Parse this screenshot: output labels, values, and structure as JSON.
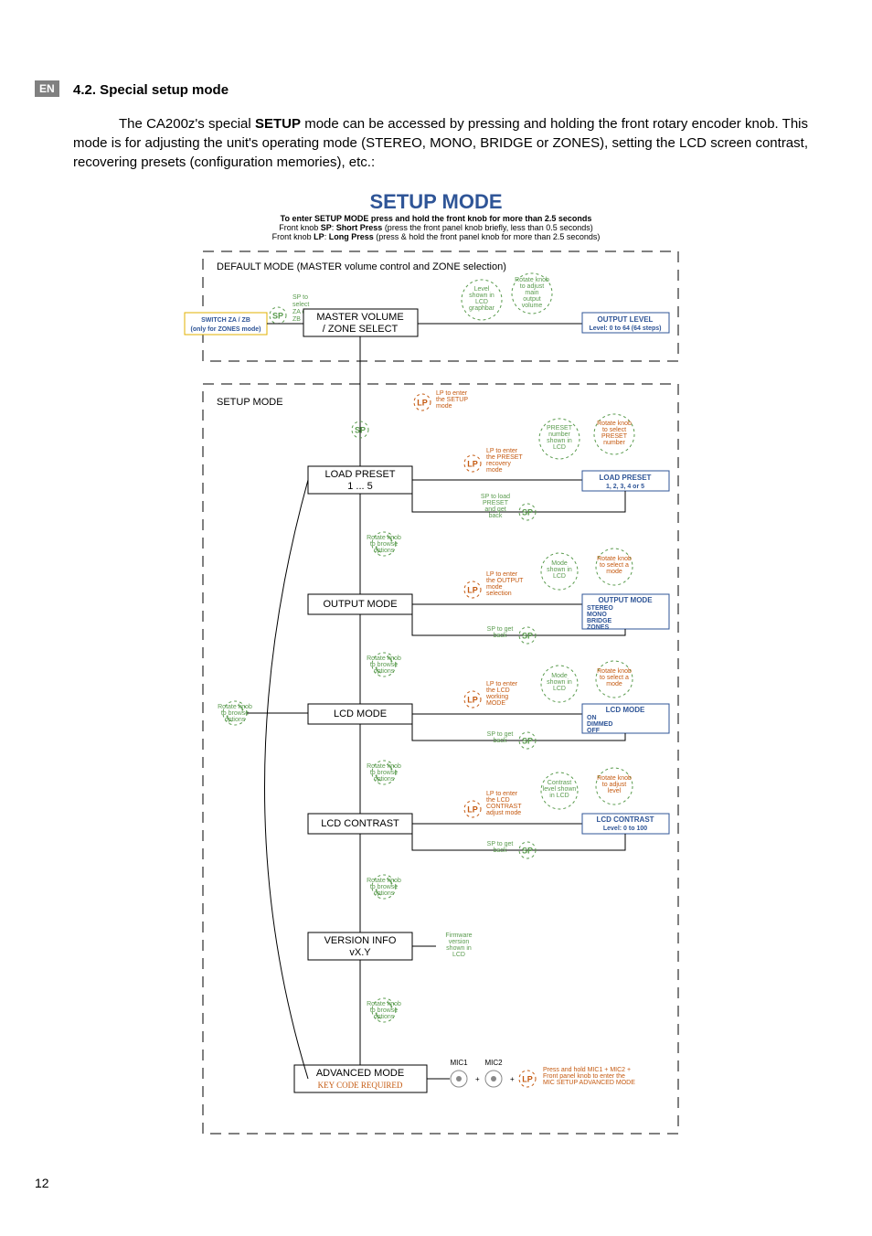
{
  "badge": "EN",
  "pageNumber": "12",
  "sectionTitle": "4.2. Special setup mode",
  "bodyHtml": "The CA200z's special <b>SETUP</b> mode can be accessed by pressing and holding the front rotary encoder knob. This mode is for adjusting the unit's operating mode (STEREO, MONO, BRIDGE or ZONES), setting the LCD screen contrast, recovering presets (configuration memories), etc.:",
  "diagram": {
    "title": "SETUP MODE",
    "subtitle1": "To enter SETUP MODE press and hold the front knob for more than 2.5 seconds",
    "subtitle2Html": "Front knob <b>SP</b>: <b>Short Press</b> (press the front panel knob briefly, less than 0.5 seconds)",
    "subtitle3Html": "Front knob <b>LP</b>: <b>Long Press</b> (press & hold the front panel knob for more than 2.5 seconds)",
    "defaultModeTitle": "DEFAULT MODE (MASTER volume control and ZONE selection)",
    "switchZone": {
      "line1": "SWITCH ZA / ZB",
      "line2": "(only for ZONES mode)"
    },
    "s1Note": "SP to select ZA or ZB",
    "masterVolume": {
      "line1": "MASTER VOLUME",
      "line2": "/ ZONE SELECT"
    },
    "levelNote": "Level shown in LCD graphbar",
    "rotateMain": "Rotate knob to adjust main output volume",
    "outputLevel": {
      "line1": "OUTPUT LEVEL",
      "line2": "Level: 0 to 64 (64 steps)"
    },
    "setupMode": "SETUP MODE",
    "lp1Note": "LP to enter the SETUP mode",
    "lp2Note": "LP to enter the PRESET recovery mode",
    "presetNote": "PRESET number shown in LCD",
    "rotatePreset": "Rotate knob to select PRESET number",
    "loadPreset": {
      "line1": "LOAD PRESET",
      "line2": "1 ... 5"
    },
    "loadPresetR": {
      "line1": "LOAD PRESET",
      "line2": "1, 2, 3, 4 or 5"
    },
    "spLoad": "SP to load PRESET and get back",
    "rotateBrowse": "Rotate knob to browse options",
    "lp3Note": "LP to enter the OUTPUT mode selection",
    "modeNote": "Mode shown in LCD",
    "rotateMode": "Rotate knob to select a mode",
    "outputMode": "OUTPUT MODE",
    "outputModeOpts": [
      "STEREO",
      "MONO",
      "BRIDGE",
      "ZONES"
    ],
    "spBack": "SP to get back",
    "lp4Note": "LP to enter the LCD working MODE",
    "lcdMode": "LCD MODE",
    "lcdModeOpts": [
      "ON",
      "DIMMED",
      "OFF"
    ],
    "lp5Note": "LP to enter the LCD CONTRAST adjust mode",
    "contrastNote": "Contrast level shown in LCD",
    "rotateLevel": "Rotate knob to adjust level",
    "lcdContrast": "LCD CONTRAST",
    "lcdContrastR": {
      "line2": "Level: 0 to 100"
    },
    "versionInfo": {
      "line1": "VERSION INFO",
      "line2": "vX.Y"
    },
    "fwNote": "Firmware version shown in LCD",
    "advancedMode": {
      "line1": "ADVANCED MODE",
      "line2": "KEY CODE REQUIRED"
    },
    "mic1": "MIC1",
    "mic2": "MIC2",
    "advNote": "Press and hold MIC1 + MIC2 + Front panel knob to enter the MIC SETUP ADVANCED MODE",
    "rotateBrowseLeft": "Rotate knob to browse options",
    "chart_data": {
      "type": "flow-diagram",
      "levels": [
        {
          "id": "default-mode",
          "label": "DEFAULT MODE (MASTER volume control and ZONE selection)",
          "children": [
            {
              "id": "switch-zone",
              "left": true,
              "via": "SP",
              "label": "SWITCH ZA / ZB (only for ZONES mode)"
            },
            {
              "id": "master-volume",
              "label": "MASTER VOLUME / ZONE SELECT",
              "right": {
                "id": "output-level",
                "label": "OUTPUT LEVEL Level: 0 to 64 (64 steps)",
                "via": "Rotate"
              }
            }
          ]
        },
        {
          "id": "setup-mode",
          "via": "LP",
          "label": "SETUP MODE",
          "options": [
            {
              "id": "load-preset",
              "label": "LOAD PRESET 1...5",
              "via": "LP",
              "right": {
                "id": "load-preset-r",
                "label": "LOAD PRESET 1,2,3,4 or 5",
                "via": "Rotate"
              },
              "back": "SP"
            },
            {
              "id": "output-mode",
              "label": "OUTPUT MODE",
              "via": "LP",
              "right": {
                "id": "output-mode-r",
                "label": "OUTPUT MODE",
                "opts": [
                  "STEREO",
                  "MONO",
                  "BRIDGE",
                  "ZONES"
                ],
                "via": "Rotate"
              },
              "back": "SP"
            },
            {
              "id": "lcd-mode",
              "label": "LCD MODE",
              "via": "LP",
              "right": {
                "id": "lcd-mode-r",
                "label": "LCD MODE",
                "opts": [
                  "ON",
                  "DIMMED",
                  "OFF"
                ],
                "via": "Rotate"
              },
              "back": "SP"
            },
            {
              "id": "lcd-contrast",
              "label": "LCD CONTRAST",
              "via": "LP",
              "right": {
                "id": "lcd-contrast-r",
                "label": "LCD CONTRAST Level: 0 to 100",
                "via": "Rotate"
              },
              "back": "SP"
            },
            {
              "id": "version-info",
              "label": "VERSION INFO vX.Y"
            },
            {
              "id": "advanced-mode",
              "label": "ADVANCED MODE KEY CODE REQUIRED",
              "action": "MIC1+MIC2+LP"
            }
          ]
        }
      ]
    }
  }
}
